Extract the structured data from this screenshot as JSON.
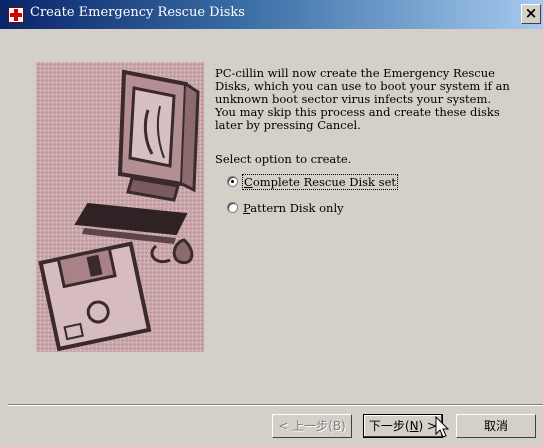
{
  "window": {
    "title": "Create Emergency Rescue Disks",
    "close_glyph": "×"
  },
  "main": {
    "message": "PC-cillin will now create the Emergency Rescue Disks, which you can use to boot your system if an unknown boot sector virus infects your system. You may skip this process and create these disks later by pressing Cancel.",
    "select_label": "Select option to create.",
    "options": [
      {
        "label_mnemonic": "C",
        "label_rest": "omplete Rescue Disk set",
        "checked": true
      },
      {
        "label_mnemonic": "P",
        "label_rest": "attern Disk only",
        "checked": false
      }
    ]
  },
  "buttons": {
    "back": "< 上一步(B)",
    "next_text": "下一步(",
    "next_mnemonic": "N",
    "next_suffix": ") >",
    "cancel": "取消"
  },
  "icons": {
    "title_icon": "rescue-cross-icon",
    "illustration": "computer-floppy-illustration",
    "cursor": "mouse-pointer-icon"
  },
  "colors": {
    "titlebar_start": "#0a246a",
    "titlebar_end": "#a6caf0",
    "illustration_bg": "#c6a4a8",
    "dialog_bg": "#d4d0c8"
  }
}
